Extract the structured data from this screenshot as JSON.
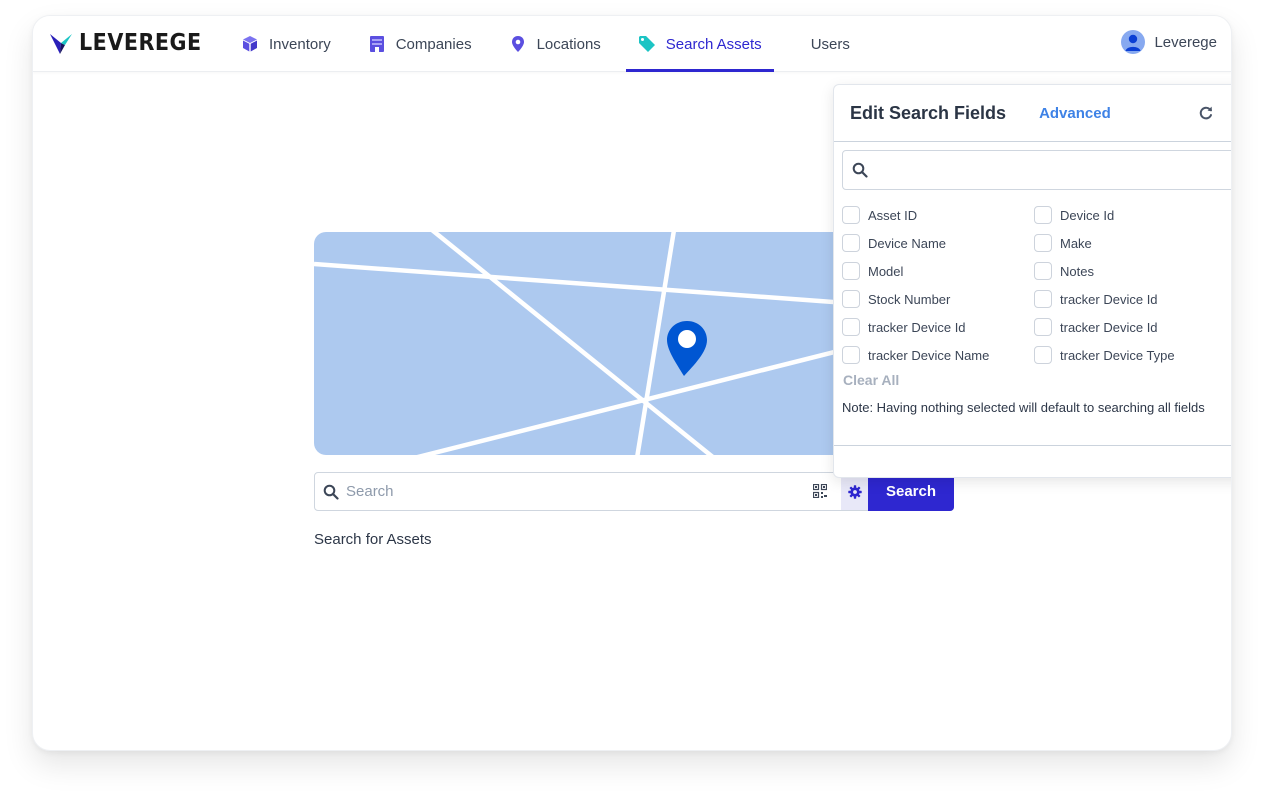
{
  "app": {
    "logo_text": "LEVEREGE"
  },
  "nav": {
    "items": [
      {
        "label": "Inventory",
        "icon": "cube-icon",
        "active": false
      },
      {
        "label": "Companies",
        "icon": "building-icon",
        "active": false
      },
      {
        "label": "Locations",
        "icon": "map-pin-icon",
        "active": false
      },
      {
        "label": "Search Assets",
        "icon": "tag-icon",
        "active": true
      },
      {
        "label": "Users",
        "icon": "",
        "active": false
      }
    ],
    "user_name": "Leverege"
  },
  "search": {
    "placeholder": "Search",
    "value": "",
    "button_label": "Search",
    "hint": "Search for Assets"
  },
  "popover": {
    "title": "Edit Search Fields",
    "advanced_label": "Advanced",
    "search_value": "",
    "fields": [
      {
        "label": "Asset ID",
        "checked": false
      },
      {
        "label": "Device Id",
        "checked": false
      },
      {
        "label": "Device Name",
        "checked": false
      },
      {
        "label": "Make",
        "checked": false
      },
      {
        "label": "Model",
        "checked": false
      },
      {
        "label": "Notes",
        "checked": false
      },
      {
        "label": "Stock Number",
        "checked": false
      },
      {
        "label": "tracker Device Id",
        "checked": false
      },
      {
        "label": "tracker Device Id",
        "checked": false
      },
      {
        "label": "tracker Device Id",
        "checked": false
      },
      {
        "label": "tracker Device Name",
        "checked": false
      },
      {
        "label": "tracker Device Type",
        "checked": false
      }
    ],
    "clear_all_label": "Clear All",
    "note": "Note: Having nothing selected will default to searching all fields"
  },
  "colors": {
    "primary": "#2e27d0",
    "accent_teal": "#1cc4c4",
    "nav_icon": "#5b4fe0",
    "link": "#3e82e6",
    "map_bg": "#adc9ef",
    "pin": "#0056d2"
  }
}
